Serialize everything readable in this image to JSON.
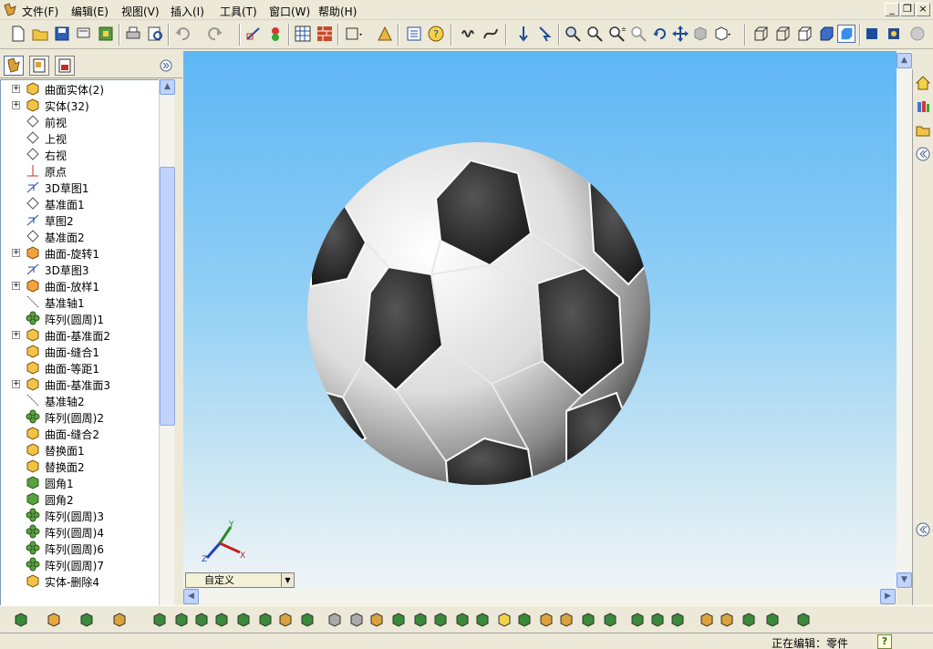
{
  "menus": [
    "文件(F)",
    "编辑(E)",
    "视图(V)",
    "插入(I)",
    "工具(T)",
    "窗口(W)",
    "帮助(H)"
  ],
  "tree": [
    {
      "label": "曲面实体(2)",
      "icon": "surface-bodies-folder-icon",
      "expand": "+"
    },
    {
      "label": "实体(32)",
      "icon": "solid-bodies-folder-icon",
      "expand": "+"
    },
    {
      "label": "前视",
      "icon": "plane-icon",
      "expand": ""
    },
    {
      "label": "上视",
      "icon": "plane-icon",
      "expand": ""
    },
    {
      "label": "右视",
      "icon": "plane-icon",
      "expand": ""
    },
    {
      "label": "原点",
      "icon": "origin-icon",
      "expand": ""
    },
    {
      "label": "3D草图1",
      "icon": "sketch-3d-icon",
      "expand": ""
    },
    {
      "label": "基准面1",
      "icon": "plane-icon",
      "expand": ""
    },
    {
      "label": "草图2",
      "icon": "sketch-icon",
      "expand": ""
    },
    {
      "label": "基准面2",
      "icon": "plane-icon",
      "expand": ""
    },
    {
      "label": "曲面-旋转1",
      "icon": "surface-revolve-icon",
      "expand": "+"
    },
    {
      "label": "3D草图3",
      "icon": "sketch-3d-icon",
      "expand": ""
    },
    {
      "label": "曲面-放样1",
      "icon": "surface-loft-icon",
      "expand": "+"
    },
    {
      "label": "基准轴1",
      "icon": "axis-icon",
      "expand": ""
    },
    {
      "label": "阵列(圆周)1",
      "icon": "circular-pattern-icon",
      "expand": ""
    },
    {
      "label": "曲面-基准面2",
      "icon": "surface-plane-icon",
      "expand": "+"
    },
    {
      "label": "曲面-缝合1",
      "icon": "surface-knit-icon",
      "expand": ""
    },
    {
      "label": "曲面-等距1",
      "icon": "surface-offset-icon",
      "expand": ""
    },
    {
      "label": "曲面-基准面3",
      "icon": "surface-plane-icon",
      "expand": "+"
    },
    {
      "label": "基准轴2",
      "icon": "axis-icon",
      "expand": ""
    },
    {
      "label": "阵列(圆周)2",
      "icon": "circular-pattern-icon",
      "expand": ""
    },
    {
      "label": "曲面-缝合2",
      "icon": "surface-knit-icon",
      "expand": ""
    },
    {
      "label": "替换面1",
      "icon": "replace-face-icon",
      "expand": ""
    },
    {
      "label": "替换面2",
      "icon": "replace-face-icon",
      "expand": ""
    },
    {
      "label": "圆角1",
      "icon": "fillet-icon",
      "expand": ""
    },
    {
      "label": "圆角2",
      "icon": "fillet-icon",
      "expand": ""
    },
    {
      "label": "阵列(圆周)3",
      "icon": "circular-pattern-icon",
      "expand": ""
    },
    {
      "label": "阵列(圆周)4",
      "icon": "circular-pattern-icon",
      "expand": ""
    },
    {
      "label": "阵列(圆周)6",
      "icon": "circular-pattern-icon",
      "expand": ""
    },
    {
      "label": "阵列(圆周)7",
      "icon": "circular-pattern-icon",
      "expand": ""
    },
    {
      "label": "实体-删除4",
      "icon": "delete-body-icon",
      "expand": ""
    }
  ],
  "view": {
    "orientation_label": "自定义"
  },
  "status": {
    "text": "正在编辑：零件",
    "help": "?"
  },
  "window": {
    "minimize": "_",
    "restore": "❐",
    "close": "×"
  }
}
